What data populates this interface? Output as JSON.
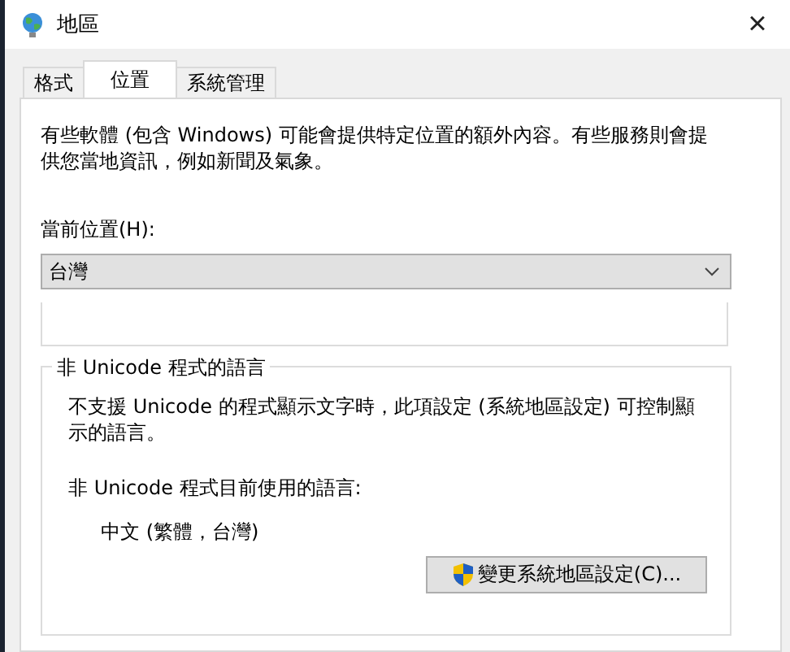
{
  "window": {
    "title": "地區",
    "close": "×"
  },
  "tabs": [
    {
      "label": "格式",
      "selected": false
    },
    {
      "label": "位置",
      "selected": true
    },
    {
      "label": "系統管理",
      "selected": false
    }
  ],
  "description": "有些軟體 (包含 Windows) 可能會提供特定位置的額外內容。有些服務則會提供您當地資訊，例如新聞及氣象。",
  "location": {
    "label": "當前位置(H):",
    "value": "台灣"
  },
  "group": {
    "title": "非 Unicode 程式的語言",
    "description": "不支援 Unicode 的程式顯示文字時，此項設定 (系統地區設定) 可控制顯示的語言。",
    "current_label": "非 Unicode 程式目前使用的語言:",
    "current_value": "中文 (繁體，台灣)",
    "button": "變更系統地區設定(C)..."
  }
}
